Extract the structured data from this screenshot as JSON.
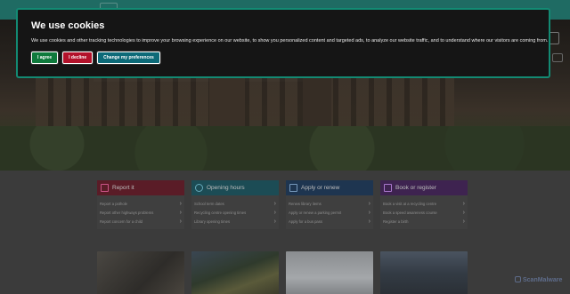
{
  "cookie_banner": {
    "title": "We use cookies",
    "message": "We use cookies and other tracking technologies to improve your browsing experience on our website, to show you personalized content and targeted ads, to analyze our website traffic, and to understand where our visitors are coming from.",
    "agree_label": "I agree",
    "decline_label": "I decline",
    "preferences_label": "Change my preferences"
  },
  "quick_links": [
    {
      "title": "Report it",
      "icon": "warning-icon",
      "color": "#c2163a",
      "links": [
        "Report a pothole",
        "Report other highways problems",
        "Report concern for a child"
      ]
    },
    {
      "title": "Opening hours",
      "icon": "clock-icon",
      "color": "#0a7a8a",
      "links": [
        "School term dates",
        "Recycling centre opening times",
        "Library opening times"
      ]
    },
    {
      "title": "Apply or renew",
      "icon": "form-icon",
      "color": "#1a4f8a",
      "links": [
        "Renew library items",
        "Apply or renew a parking permit",
        "Apply for a bus pass"
      ]
    },
    {
      "title": "Book or register",
      "icon": "calendar-icon",
      "color": "#6a1f8a",
      "links": [
        "Book a visit at a recycling centre",
        "Book a speed awareness course",
        "Register a birth"
      ]
    }
  ],
  "watermark": "ScanMalware"
}
